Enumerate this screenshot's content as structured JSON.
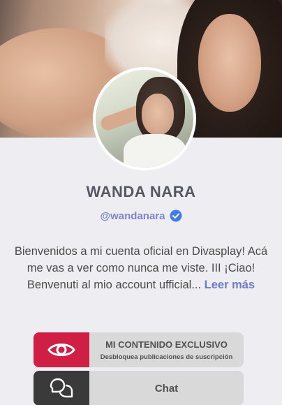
{
  "profile": {
    "name": "WANDA NARA",
    "handle": "@wandanara",
    "bio_text": "Bienvenidos a mi cuenta oficial en Divasplay! Acá me vas a ver como nunca me viste. III ¡Ciao! Benvenuti al mio account ufficial...",
    "read_more": "Leer más"
  },
  "buttons": {
    "exclusive_title": "MI CONTENIDO EXCLUSIVO",
    "exclusive_subtitle": "Desbloquea publicaciones de suscripción",
    "exclusive_icon": "eye-icon",
    "chat_label": "Chat",
    "chat_icon": "chat-bubbles-icon"
  },
  "colors": {
    "accent_red": "#cf1f45",
    "handle_blue": "#7c86c6",
    "verified_blue": "#3f7ce6",
    "button_gray": "#d9d9d9",
    "chat_icon_bg": "#3a3a3a"
  }
}
